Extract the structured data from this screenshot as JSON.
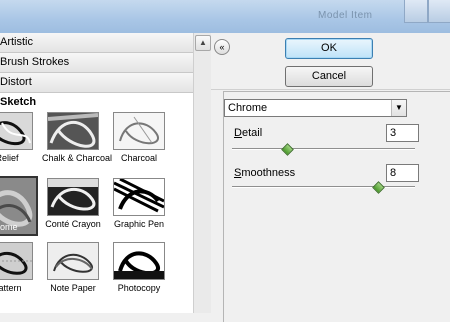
{
  "title_ghost": "Model Item",
  "filter_gallery": {
    "categories_before": [
      "Artistic",
      "Brush Strokes",
      "Distort"
    ],
    "open_category": "Sketch",
    "thumbnails": [
      {
        "label": "Relief",
        "style": "bright"
      },
      {
        "label": "Chalk & Charcoal",
        "style": "dark"
      },
      {
        "label": "Charcoal",
        "style": "light"
      },
      {
        "label": "ome",
        "style": "gray",
        "selected": true
      },
      {
        "label": "Conté Crayon",
        "style": "dark"
      },
      {
        "label": "Graphic Pen",
        "style": "black"
      },
      {
        "label": "Pattern",
        "style": "bright"
      },
      {
        "label": "Note Paper",
        "style": "light"
      },
      {
        "label": "Photocopy",
        "style": "black"
      }
    ]
  },
  "buttons": {
    "ok": "OK",
    "cancel": "Cancel"
  },
  "filter_select": {
    "selected": "Chrome"
  },
  "params": {
    "detail": {
      "label_u": "D",
      "label_rest": "etail",
      "value": "3",
      "max": 10
    },
    "smoothness": {
      "label_u": "S",
      "label_rest": "moothness",
      "value": "8",
      "max": 10
    }
  },
  "colors": {
    "accent": "#3c7fb1",
    "slider_thumb": "#4a9a2a"
  }
}
